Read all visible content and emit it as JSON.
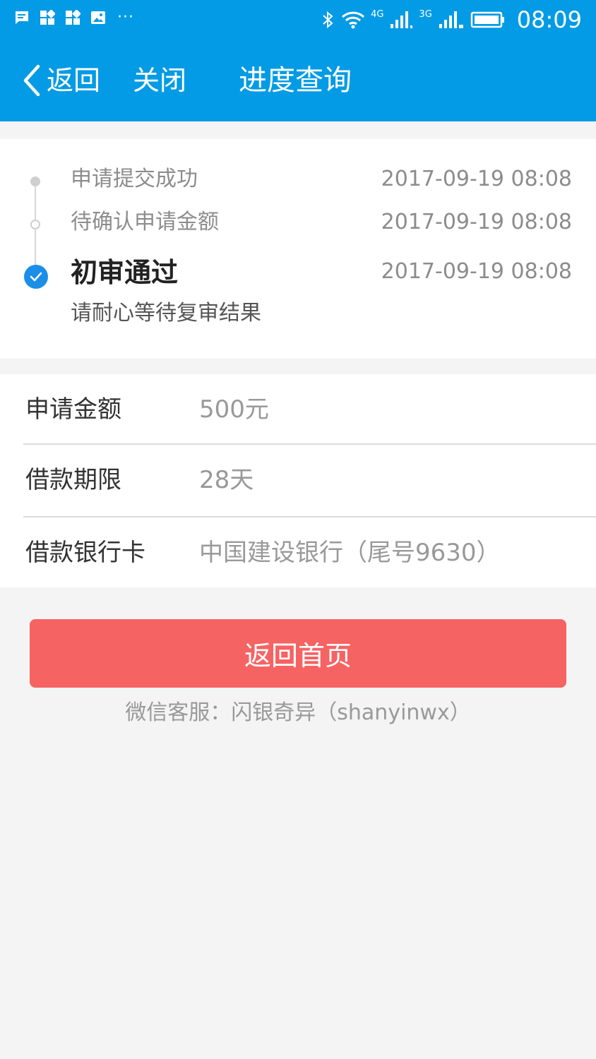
{
  "status_bar": {
    "notif_icons": [
      "message-icon",
      "app-grid-icon",
      "app-grid-icon",
      "image-icon"
    ],
    "more": "···",
    "net_4g": "4G",
    "net_3g": "3G",
    "time": "08:09"
  },
  "header": {
    "back_label": "返回",
    "close_label": "关闭",
    "title": "进度查询",
    "color": "#039be5"
  },
  "progress": {
    "steps": [
      {
        "label": "申请提交成功",
        "time": "2017-09-19 08:08",
        "state": "done"
      },
      {
        "label": "待确认申请金额",
        "time": "2017-09-19 08:08",
        "state": "done"
      },
      {
        "label": "初审通过",
        "time": "2017-09-19 08:08",
        "state": "current"
      }
    ],
    "hint": "请耐心等待复审结果",
    "accent": "#1b8fe8"
  },
  "details": [
    {
      "label": "申请金额",
      "value": "500元"
    },
    {
      "label": "借款期限",
      "value": "28天"
    },
    {
      "label": "借款银行卡",
      "value": "中国建设银行（尾号9630）"
    }
  ],
  "actions": {
    "home_label": "返回首页",
    "home_color": "#f66363"
  },
  "footer": {
    "service_note": "微信客服：闪银奇异（shanyinwx）"
  }
}
